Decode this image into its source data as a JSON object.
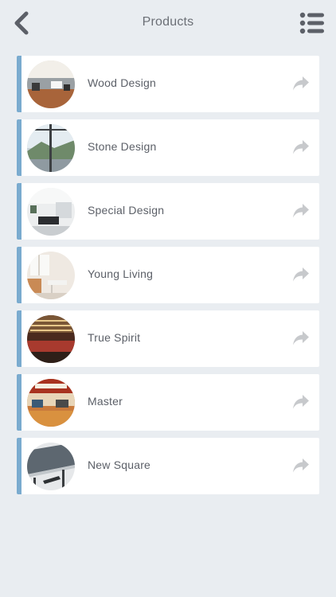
{
  "header": {
    "title": "Products",
    "back_icon": "chevron-left-icon",
    "menu_icon": "list-icon"
  },
  "colors": {
    "accent_bar": "#7aabcf",
    "background": "#e9edf1",
    "card": "#ffffff",
    "icon": "#6b6f76"
  },
  "products": [
    {
      "label": "Wood Design",
      "thumb_icon": "wood-design-thumbnail",
      "action_icon": "share-arrow-icon"
    },
    {
      "label": "Stone Design",
      "thumb_icon": "stone-design-thumbnail",
      "action_icon": "share-arrow-icon"
    },
    {
      "label": "Special Design",
      "thumb_icon": "special-design-thumbnail",
      "action_icon": "share-arrow-icon"
    },
    {
      "label": "Young Living",
      "thumb_icon": "young-living-thumbnail",
      "action_icon": "share-arrow-icon"
    },
    {
      "label": "True Spirit",
      "thumb_icon": "true-spirit-thumbnail",
      "action_icon": "share-arrow-icon"
    },
    {
      "label": "Master",
      "thumb_icon": "master-thumbnail",
      "action_icon": "share-arrow-icon"
    },
    {
      "label": "New Square",
      "thumb_icon": "new-square-thumbnail",
      "action_icon": "share-arrow-icon"
    }
  ]
}
